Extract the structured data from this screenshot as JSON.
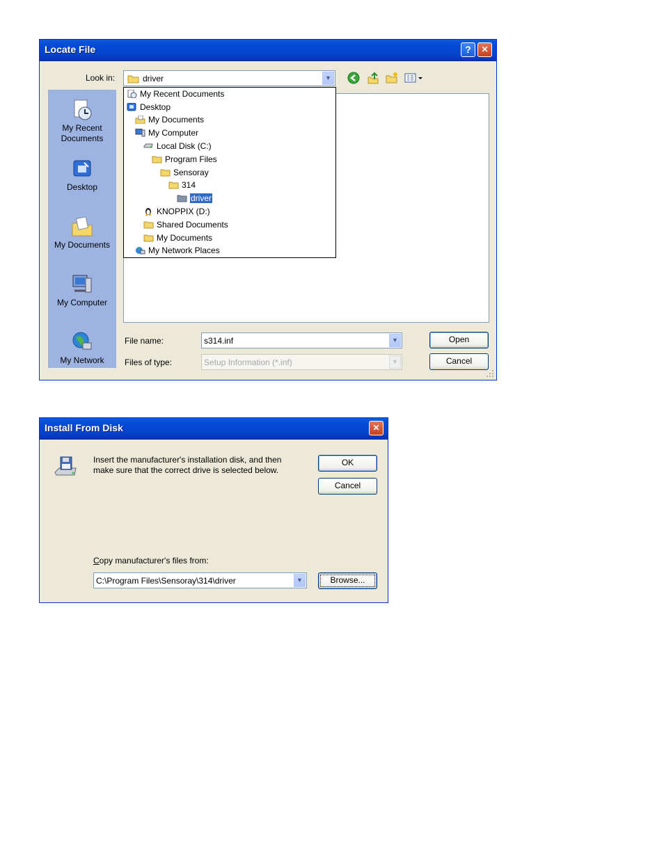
{
  "locate": {
    "title": "Locate File",
    "help_label": "?",
    "close_label": "✕",
    "lookin_label": "Look in:",
    "lookin_value": "driver",
    "dropdown_items": [
      {
        "label": "My Recent Documents",
        "icon": "recent-docs-icon"
      },
      {
        "label": "Desktop",
        "icon": "desktop-icon"
      },
      {
        "label": "My Documents",
        "icon": "my-documents-icon"
      },
      {
        "label": "My Computer",
        "icon": "my-computer-icon"
      },
      {
        "label": "Local Disk (C:)",
        "icon": "hard-disk-icon"
      },
      {
        "label": "Program Files",
        "icon": "folder-icon"
      },
      {
        "label": "Sensoray",
        "icon": "folder-icon"
      },
      {
        "label": "314",
        "icon": "folder-icon"
      },
      {
        "label": "driver",
        "icon": "folder-open-icon",
        "selected": true
      },
      {
        "label": "KNOPPIX (D:)",
        "icon": "linux-drive-icon"
      },
      {
        "label": "Shared Documents",
        "icon": "folder-icon"
      },
      {
        "label": "My Documents",
        "icon": "folder-icon"
      },
      {
        "label": "My Network Places",
        "icon": "network-places-icon"
      }
    ],
    "places": [
      {
        "label": "My Recent Documents",
        "icon": "recent-docs-icon"
      },
      {
        "label": "Desktop",
        "icon": "desktop-icon"
      },
      {
        "label": "My Documents",
        "icon": "my-documents-icon"
      },
      {
        "label": "My Computer",
        "icon": "my-computer-icon"
      },
      {
        "label": "My Network",
        "icon": "network-icon"
      }
    ],
    "filename_label": "File name:",
    "filename_value": "s314.inf",
    "filetype_label": "Files of type:",
    "filetype_value": "Setup Information (*.inf)",
    "open_label": "Open",
    "cancel_label": "Cancel"
  },
  "install": {
    "title": "Install From Disk",
    "close_label": "✕",
    "message_line1": "Insert the manufacturer's installation disk, and then",
    "message_line2": "make sure that the correct drive is selected below.",
    "ok_label": "OK",
    "cancel_label": "Cancel",
    "copy_label": "Copy manufacturer's files from:",
    "path_value": "C:\\Program Files\\Sensoray\\314\\driver",
    "browse_label": "Browse..."
  }
}
